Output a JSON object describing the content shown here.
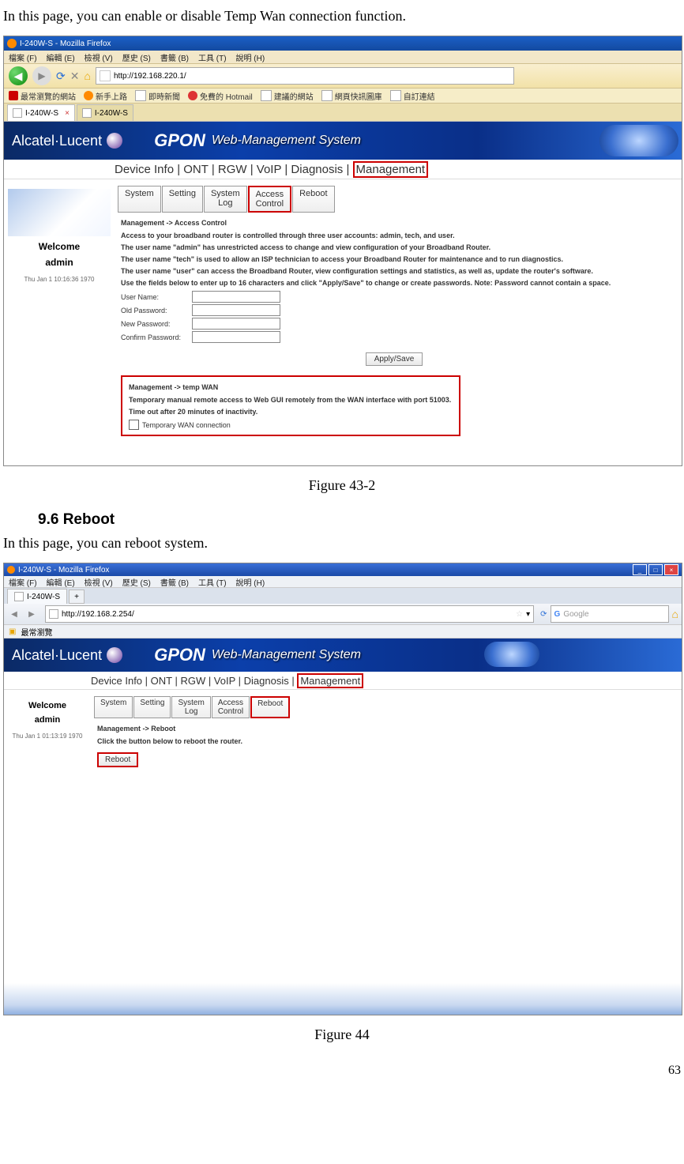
{
  "text": {
    "intro1": "In this page, you can enable or disable Temp Wan connection function.",
    "figcap1": "Figure 43-2",
    "sechead": "9.6    Reboot",
    "intro2": "In this page, you can reboot system.",
    "figcap2": "Figure 44",
    "pagenum": "63"
  },
  "ss1": {
    "title": "I-240W-S - Mozilla Firefox",
    "menu": [
      "檔案 (F)",
      "編輯 (E)",
      "檢視 (V)",
      "歷史 (S)",
      "書籤 (B)",
      "工具 (T)",
      "說明 (H)"
    ],
    "url": "http://192.168.220.1/",
    "bookmarks": [
      "最常瀏覽的網站",
      "新手上路",
      "即時新聞",
      "免費的 Hotmail",
      "建議的網站",
      "網頁快訊圖庫",
      "自訂連結"
    ],
    "tabs": [
      "I-240W-S",
      "I-240W-S"
    ],
    "brand": "Alcatel·Lucent",
    "gpon": "GPON",
    "wms": "Web-Management System",
    "crumb_pre": "Device Info | ONT | RGW | VoIP | Diagnosis | ",
    "crumb_hl": "Management",
    "welcome": "Welcome",
    "user": "admin",
    "timestamp": "Thu Jan 1 10:16:36 1970",
    "subtabs": {
      "system": "System",
      "setting": "Setting",
      "syslog1": "System",
      "syslog2": "Log",
      "access1": "Access",
      "access2": "Control",
      "reboot": "Reboot"
    },
    "breadcrumb": "Management -> Access Control",
    "lines": [
      "Access to your broadband router is controlled through three user accounts: admin, tech, and user.",
      "The user name \"admin\" has unrestricted access to change and view configuration of your Broadband Router.",
      "The user name \"tech\" is used to allow an ISP technician to access your Broadband Router for maintenance and to run diagnostics.",
      "The user name \"user\" can access the Broadband Router, view configuration settings and statistics, as well as, update the router's software.",
      "Use the fields below to enter up to 16 characters and click \"Apply/Save\" to change or create passwords. Note: Password cannot contain a space."
    ],
    "form": {
      "username": "User Name:",
      "oldpw": "Old Password:",
      "newpw": "New Password:",
      "confpw": "Confirm Password:"
    },
    "applybtn": "Apply/Save",
    "hl": {
      "bc": "Management -> temp WAN",
      "l1": "Temporary manual remote access to Web GUI remotely from the WAN interface with port 51003.",
      "l2": "Time out after 20 minutes of inactivity.",
      "cb": "Temporary WAN connection"
    }
  },
  "ss2": {
    "title": "I-240W-S - Mozilla Firefox",
    "menu": [
      "檔案 (F)",
      "編輯 (E)",
      "檢視 (V)",
      "歷史 (S)",
      "書籤 (B)",
      "工具 (T)",
      "說明 (H)"
    ],
    "tab": "I-240W-S",
    "url": "http://192.168.2.254/",
    "search_ph": "Google",
    "bm": "最常瀏覽",
    "brand": "Alcatel·Lucent",
    "gpon": "GPON",
    "wms": "Web-Management System",
    "crumb_pre": "Device Info | ONT | RGW | VoIP | Diagnosis | ",
    "crumb_hl": "Management",
    "welcome": "Welcome",
    "user": "admin",
    "timestamp": "Thu Jan 1 01:13:19 1970",
    "subtabs": {
      "system": "System",
      "setting": "Setting",
      "syslog1": "System",
      "syslog2": "Log",
      "access1": "Access",
      "access2": "Control",
      "reboot": "Reboot"
    },
    "breadcrumb": "Management -> Reboot",
    "line": "Click the button below to reboot the router.",
    "btn": "Reboot"
  }
}
